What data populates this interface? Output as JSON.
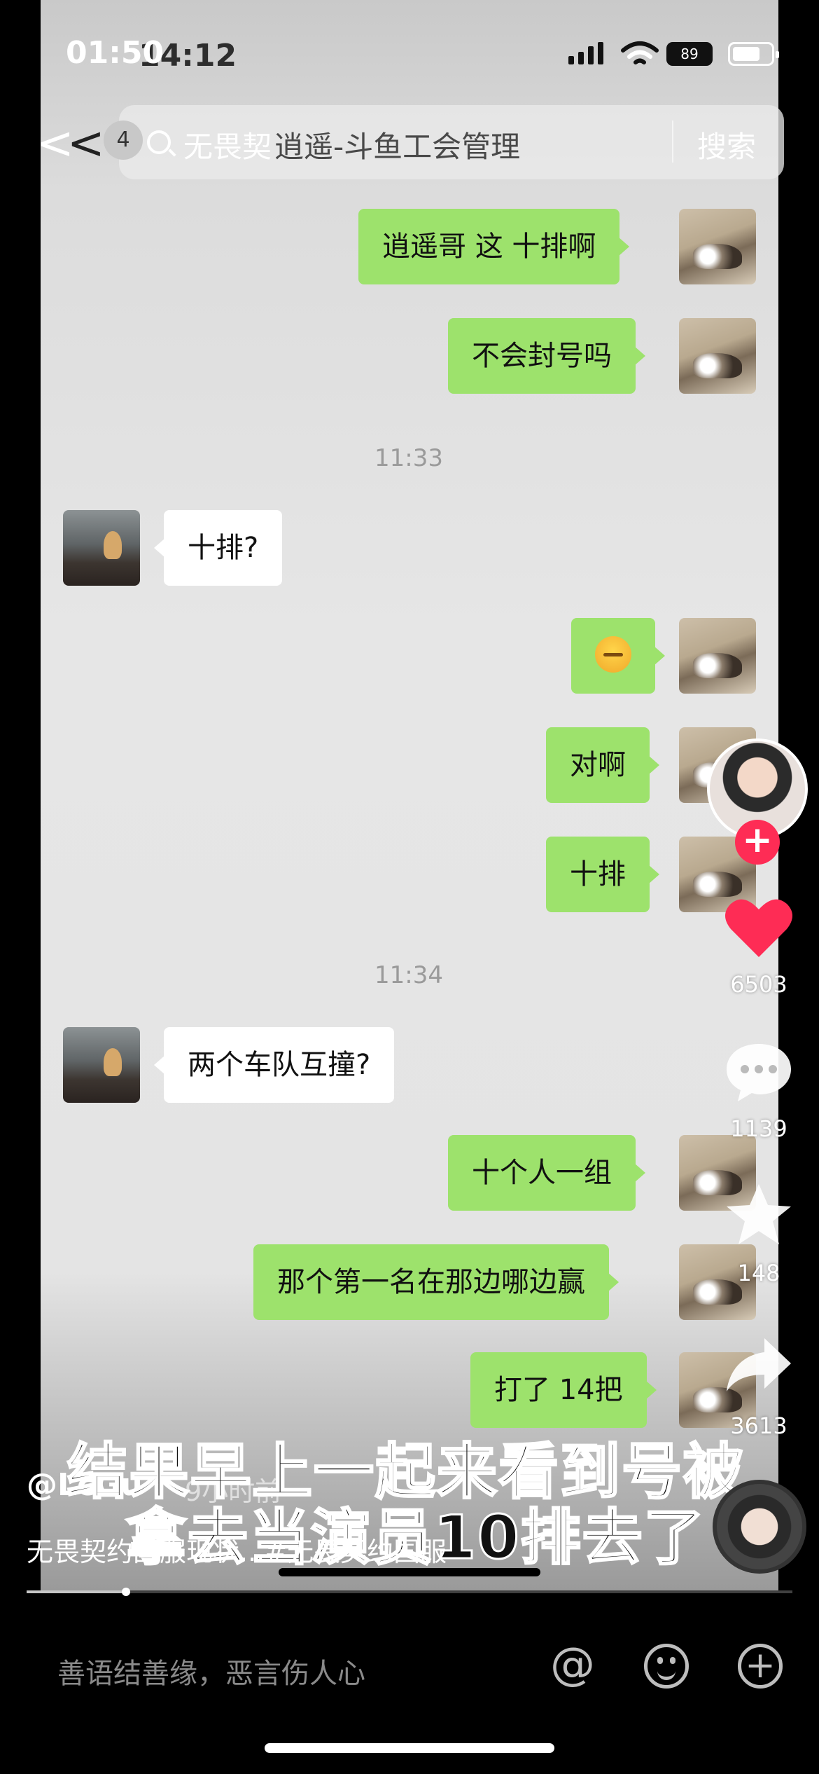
{
  "status_bar": {
    "time_overlay": "01:50",
    "time_video": "14:12",
    "battery_video": "89"
  },
  "search": {
    "back_label": "<",
    "badge": "4",
    "query_part1": "无畏契",
    "query_part2": "逍遥-斗鱼工会管理",
    "button": "搜索"
  },
  "chat": {
    "messages": [
      {
        "side": "me",
        "text": "逍遥哥  这 十排啊"
      },
      {
        "side": "me",
        "text": "不会封号吗"
      },
      {
        "timestamp": "11:33"
      },
      {
        "side": "other",
        "text": "十排?"
      },
      {
        "side": "me",
        "emoji": "sleepy-face"
      },
      {
        "side": "me",
        "text": "对啊"
      },
      {
        "side": "me",
        "text": "十排"
      },
      {
        "timestamp": "11:34"
      },
      {
        "side": "other",
        "text": "两个车队互撞?"
      },
      {
        "side": "me",
        "text": "十个人一组"
      },
      {
        "side": "me",
        "text": "那个第一名在那边哪边赢"
      },
      {
        "side": "me",
        "text": "打了 14把"
      }
    ]
  },
  "subtitle": {
    "line1": "结果早上一起来看到号被",
    "line2": "拿去当演员10排去了"
  },
  "post": {
    "author": "@LcGu",
    "time_ago": "9小时前",
    "caption": "无畏契约国服现状...#无畏契约国服"
  },
  "rail": {
    "likes": "6503",
    "comments": "1139",
    "favorites": "148",
    "shares": "3613",
    "follow": "+"
  },
  "progress": {
    "fraction": 0.13
  },
  "bottom": {
    "comment_placeholder": "善语结善缘，恶言伤人心",
    "at": "@"
  },
  "colors": {
    "my_bubble": "#9de26c",
    "like_red": "#fe2c55"
  }
}
